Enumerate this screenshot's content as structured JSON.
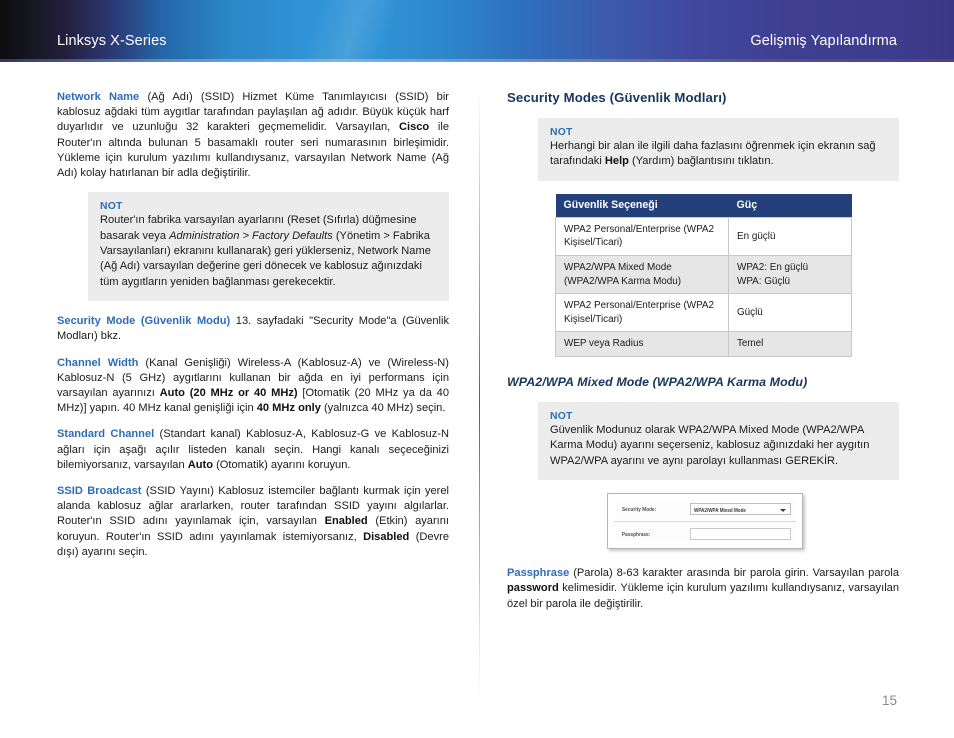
{
  "header": {
    "left_title": "Linksys X-Series",
    "right_title": "Gelişmiş Yapılandırma"
  },
  "left_column": {
    "p_network_name": {
      "term": "Network Name",
      "rest": " (Ağ Adı) (SSID)   Hizmet Küme Tanımlayıcısı (SSID) bir kablosuz ağdaki tüm aygıtlar tarafından paylaşılan ağ adıdır. Büyük küçük harf duyarlıdır ve uzunluğu 32 karakteri geçmemelidir. Varsayılan, ",
      "bold1": "Cisco",
      "rest2": " ile Router'ın altında bulunan 5 basamaklı router seri numarasının birleşimidir. Yükleme için kurulum yazılımı kullandıysanız, varsayılan Network Name (Ağ Adı) kolay hatırlanan bir adla değiştirilir."
    },
    "note1": {
      "label": "NOT",
      "part1": "Router'ın fabrika varsayılan ayarlarını (Reset (Sıfırla) düğmesine basarak veya ",
      "italic1": "Administration > Factory Defaults",
      "part2": " (Yönetim > Fabrika Varsayılanları) ekranını kullanarak) geri yüklerseniz, Network Name (Ağ Adı) varsayılan değerine geri dönecek ve kablosuz ağınızdaki tüm aygıtların yeniden bağlanması gerekecektir."
    },
    "p_security_mode": {
      "term": "Security Mode (Güvenlik Modu)",
      "rest": "  13. sayfadaki \"Security Mode\"a (Güvenlik Modları) bkz."
    },
    "p_channel_width": {
      "term": "Channel Width",
      "rest": " (Kanal Genişliği) Wireless-A (Kablosuz-A) ve (Wireless-N) Kablosuz-N (5 GHz) aygıtlarını kullanan bir ağda en iyi performans için varsayılan ayarınızı ",
      "bold1": "Auto (20 MHz or 40 MHz)",
      "rest2": " [Otomatik (20 MHz ya da 40 MHz)] yapın. 40 MHz kanal genişliği için ",
      "bold2": "40 MHz only",
      "rest3": " (yalnızca 40 MHz) seçin."
    },
    "p_standard_channel": {
      "term": "Standard Channel",
      "rest": " (Standart kanal) Kablosuz-A, Kablosuz-G ve Kablosuz-N ağları için aşağı açılır listeden kanalı seçin. Hangi kanalı seçeceğinizi bilemiyorsanız, varsayılan ",
      "bold1": "Auto",
      "rest2": " (Otomatik) ayarını koruyun."
    },
    "p_ssid_broadcast": {
      "term": "SSID Broadcast",
      "rest": " (SSID Yayını)  Kablosuz istemciler bağlantı kurmak için yerel alanda kablosuz ağlar ararlarken, router tarafından SSID yayını algılarlar. Router'ın SSID adını yayınlamak için, varsayılan ",
      "bold1": "Enabled",
      "rest2": " (Etkin) ayarını koruyun. Router'ın SSID adını yayınlamak istemiyorsanız, ",
      "bold2": "Disabled",
      "rest3": " (Devre dışı) ayarını seçin."
    }
  },
  "right_column": {
    "section_title": "Security Modes (Güvenlik Modları)",
    "note2": {
      "label": "NOT",
      "part1": "Herhangi bir alan ile ilgili daha fazlasını öğrenmek için ekranın sağ tarafındaki ",
      "bold1": "Help",
      "part2": " (Yardım) bağlantısını tıklatın."
    },
    "table": {
      "headers": [
        "Güvenlik Seçeneği",
        "Güç"
      ],
      "rows": [
        [
          "WPA2 Personal/Enterprise (WPA2 Kişisel/Ticari)",
          "En güçlü"
        ],
        [
          "WPA2/WPA Mixed Mode (WPA2/WPA Karma Modu)",
          "WPA2: En güçlü\nWPA: Güçlü"
        ],
        [
          "WPA2 Personal/Enterprise (WPA2 Kişisel/Ticari)",
          "Güçlü"
        ],
        [
          "WEP veya Radius",
          "Temel"
        ]
      ]
    },
    "subsection_title": "WPA2/WPA Mixed Mode (WPA2/WPA Karma Modu)",
    "note3": {
      "label": "NOT",
      "text": "Güvenlik Modunuz olarak WPA2/WPA Mixed Mode (WPA2/WPA Karma Modu) ayarını seçerseniz, kablosuz ağınızdaki her aygıtın WPA2/WPA ayarını ve aynı parolayı kullanması GEREKİR."
    },
    "screenshot": {
      "security_mode_label": "Security Mode:",
      "security_mode_value": "WPA2/WPA Mixed Mode",
      "passphrase_label": "Passphrase:",
      "passphrase_value": ""
    },
    "p_passphrase": {
      "term": "Passphrase",
      "rest": " (Parola)  8-63 karakter arasında bir parola girin. Varsayılan parola ",
      "bold1": "password",
      "rest2": " kelimesidir. Yükleme için kurulum yazılımı kullandıysanız, varsayılan özel bir parola ile değiştirilir."
    }
  },
  "footer": {
    "page_number": "15"
  }
}
